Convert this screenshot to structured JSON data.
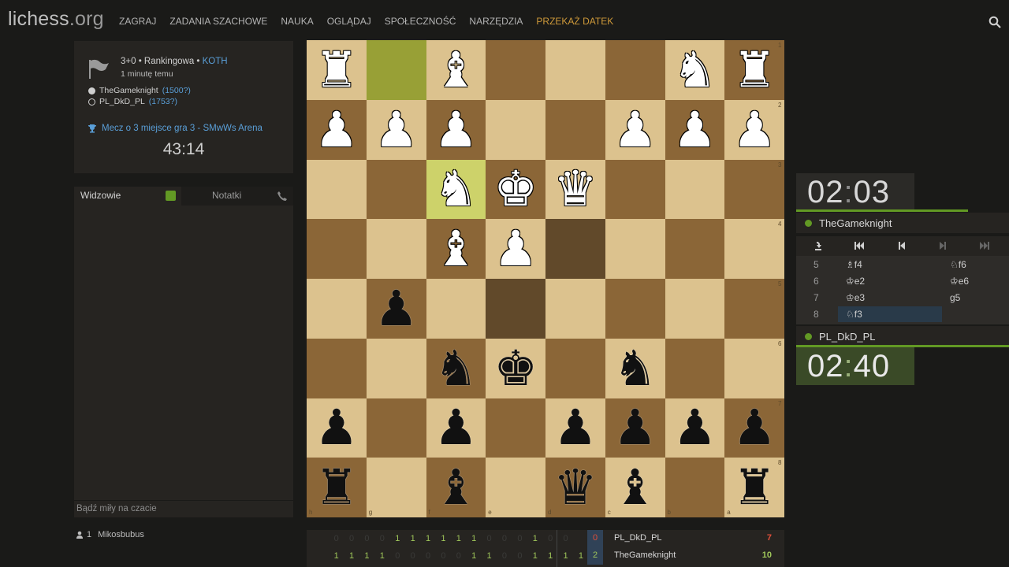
{
  "header": {
    "logo_main": "lichess",
    "logo_suffix": ".org",
    "nav": [
      "ZAGRAJ",
      "ZADANIA SZACHOWE",
      "NAUKA",
      "OGLĄDAJ",
      "SPOŁECZNOŚĆ",
      "NARZĘDZIA",
      "PRZEKAŻ DATEK"
    ],
    "search_icon": "search-icon"
  },
  "game_info": {
    "mode": "3+0 • Rankingowa • ",
    "variant": "KOTH",
    "time_ago": "1 minutę temu",
    "white_player": "TheGameknight",
    "white_rating": "(1500?)",
    "black_player": "PL_DkD_PL",
    "black_rating": "(1753?)",
    "tournament": "Mecz o 3 miejsce gra 3 - SMwWs Arena",
    "tournament_clock": "43:14"
  },
  "chat": {
    "tab_spectators": "Widzowie",
    "tab_notes": "Notatki",
    "placeholder": "Bądź miły na czacie",
    "watcher_count": "1",
    "watcher_name": "Mikosbubus"
  },
  "board": {
    "files_bottom": [
      "h",
      "g",
      "f",
      "e",
      "d",
      "c",
      "b",
      "a"
    ],
    "ranks_right": [
      "1",
      "2",
      "3",
      "4",
      "5",
      "6",
      "7",
      "8"
    ],
    "pieces": [
      {
        "sq": "h1",
        "p": "♜",
        "c": "w"
      },
      {
        "sq": "f1",
        "p": "♝",
        "c": "w"
      },
      {
        "sq": "b1",
        "p": "♞",
        "c": "w"
      },
      {
        "sq": "a1",
        "p": "♜",
        "c": "w"
      },
      {
        "sq": "h2",
        "p": "♟",
        "c": "w"
      },
      {
        "sq": "g2",
        "p": "♟",
        "c": "w"
      },
      {
        "sq": "f2",
        "p": "♟",
        "c": "w"
      },
      {
        "sq": "c2",
        "p": "♟",
        "c": "w"
      },
      {
        "sq": "b2",
        "p": "♟",
        "c": "w"
      },
      {
        "sq": "a2",
        "p": "♟",
        "c": "w"
      },
      {
        "sq": "f3",
        "p": "♞",
        "c": "w"
      },
      {
        "sq": "e3",
        "p": "♚",
        "c": "w"
      },
      {
        "sq": "d3",
        "p": "♛",
        "c": "w"
      },
      {
        "sq": "f4",
        "p": "♝",
        "c": "w"
      },
      {
        "sq": "e4",
        "p": "♟",
        "c": "w"
      },
      {
        "sq": "g5",
        "p": "♟",
        "c": "b"
      },
      {
        "sq": "f6",
        "p": "♞",
        "c": "b"
      },
      {
        "sq": "e6",
        "p": "♚",
        "c": "b"
      },
      {
        "sq": "c6",
        "p": "♞",
        "c": "b"
      },
      {
        "sq": "h7",
        "p": "♟",
        "c": "b"
      },
      {
        "sq": "f7",
        "p": "♟",
        "c": "b"
      },
      {
        "sq": "d7",
        "p": "♟",
        "c": "b"
      },
      {
        "sq": "c7",
        "p": "♟",
        "c": "b"
      },
      {
        "sq": "b7",
        "p": "♟",
        "c": "b"
      },
      {
        "sq": "a7",
        "p": "♟",
        "c": "b"
      },
      {
        "sq": "h8",
        "p": "♜",
        "c": "b"
      },
      {
        "sq": "f8",
        "p": "♝",
        "c": "b"
      },
      {
        "sq": "d8",
        "p": "♛",
        "c": "b"
      },
      {
        "sq": "c8",
        "p": "♝",
        "c": "b"
      },
      {
        "sq": "a8",
        "p": "♜",
        "c": "b"
      }
    ],
    "last_move": [
      "g1",
      "f3"
    ],
    "premove": [
      "d4",
      "e5"
    ]
  },
  "clocks": {
    "top_time_min": "02",
    "top_time_sec": "03",
    "top_player": "TheGameknight",
    "bottom_time_min": "02",
    "bottom_time_sec": "40",
    "bottom_player": "PL_DkD_PL"
  },
  "moves": [
    {
      "num": "5",
      "white": "♗f4",
      "black": "♘f6",
      "active": false
    },
    {
      "num": "6",
      "white": "♔e2",
      "black": "♔e6",
      "active": false
    },
    {
      "num": "7",
      "white": "♔e3",
      "black": "g5",
      "active": false
    },
    {
      "num": "8",
      "white": "♘f3",
      "black": "",
      "active": true
    }
  ],
  "arena": {
    "row1": {
      "scores": [
        "0",
        "0",
        "0",
        "0",
        "1",
        "1",
        "1",
        "1",
        "1",
        "1",
        "0",
        "0",
        "0",
        "1",
        "0",
        "0"
      ],
      "rank": "0",
      "name": "PL_DkD_PL",
      "total": "7",
      "total_color": "#e04f3a"
    },
    "row2": {
      "scores": [
        "1",
        "1",
        "1",
        "1",
        "0",
        "0",
        "0",
        "0",
        "0",
        "1",
        "1",
        "0",
        "0",
        "1",
        "1",
        "1",
        "1"
      ],
      "rank": "2",
      "name": "TheGameknight",
      "total": "10",
      "total_color": "#9fc65a"
    }
  }
}
